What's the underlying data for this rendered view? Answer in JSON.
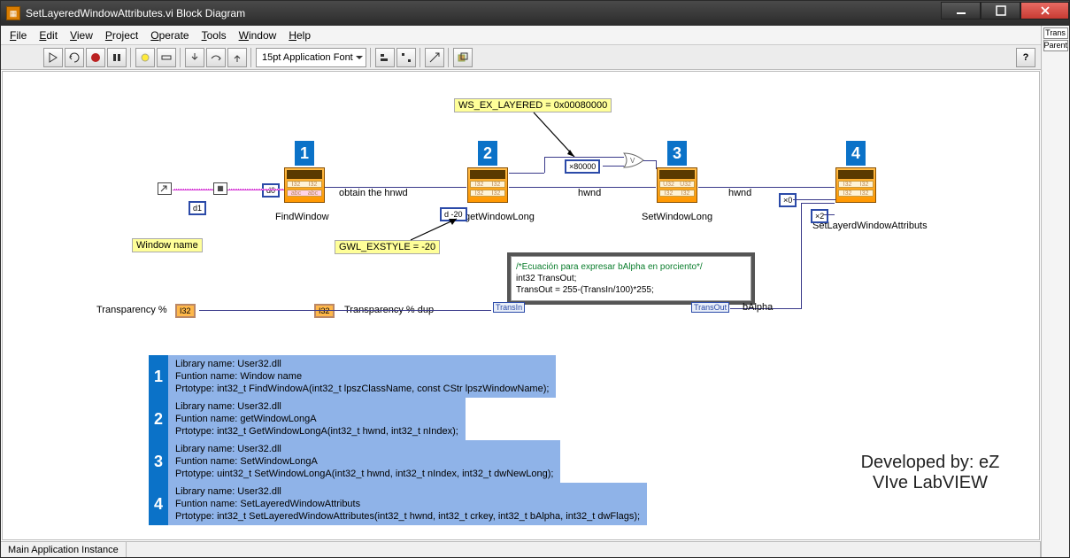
{
  "window": {
    "title": "SetLayeredWindowAttributes.vi Block Diagram"
  },
  "menu": {
    "file": "File",
    "edit": "Edit",
    "view": "View",
    "project": "Project",
    "operate": "Operate",
    "tools": "Tools",
    "window": "Window",
    "help": "Help"
  },
  "right": {
    "top": "Trans",
    "bottom": "Parent"
  },
  "toolbar": {
    "font": "15pt Application Font"
  },
  "status": {
    "instance": "Main Application Instance"
  },
  "nodes": {
    "windowname_lbl": "Window name",
    "ws_ex": "WS_EX_LAYERED   = 0x00080000",
    "gwl": "GWL_EXSTYLE = -20",
    "obtain": "obtain the hnwd",
    "hwnd1": "hwnd",
    "hwnd2": "hwnd",
    "balpha": "bAlpha",
    "x80000": "×80000",
    "x0": "×0",
    "x2": "×2",
    "d0": "d0",
    "d1": "d1",
    "dneg20": "d -20",
    "find": "FindWindow",
    "getwl": "getWindowLong",
    "setwl": "SetWindowLong",
    "slwa": "SetLayerdWindowAttributs",
    "trans_pct": "Transparency %",
    "trans_dup": "Transparency % dup",
    "i32": "I32",
    "formula_cmt": "/*Ecuación para expresar bAlpha en porciento*/",
    "formula_l1": "int32 TransOut;",
    "formula_l2": "TransOut = 255-(TransIn/100)*255;",
    "transin": "TransIn",
    "transout": "TransOut"
  },
  "info": [
    {
      "n": "1",
      "lib": "Library name: User32.dll",
      "fn": "Funtion name: Window name",
      "pt": "Prtotype: int32_t FindWindowA(int32_t lpszClassName, const CStr lpszWindowName);"
    },
    {
      "n": "2",
      "lib": "Library name: User32.dll",
      "fn": "Funtion name: getWindowLongA",
      "pt": "Prtotype: int32_t GetWindowLongA(int32_t hwnd, int32_t nIndex);"
    },
    {
      "n": "3",
      "lib": "Library name: User32.dll",
      "fn": "Funtion name: SetWindowLongA",
      "pt": "Prtotype: uint32_t SetWindowLongA(int32_t hwnd, int32_t nIndex, int32_t dwNewLong);"
    },
    {
      "n": "4",
      "lib": "Library name: User32.dll",
      "fn": "Funtion name: SetLayeredWindowAttributs",
      "pt": "Prtotype: int32_t SetLayeredWindowAttributes(int32_t hwnd, int32_t crkey, int32_t bAlpha, int32_t dwFlags);"
    }
  ],
  "credit": {
    "l1": "Developed by: eZ",
    "l2": "VIve LabVIEW"
  }
}
